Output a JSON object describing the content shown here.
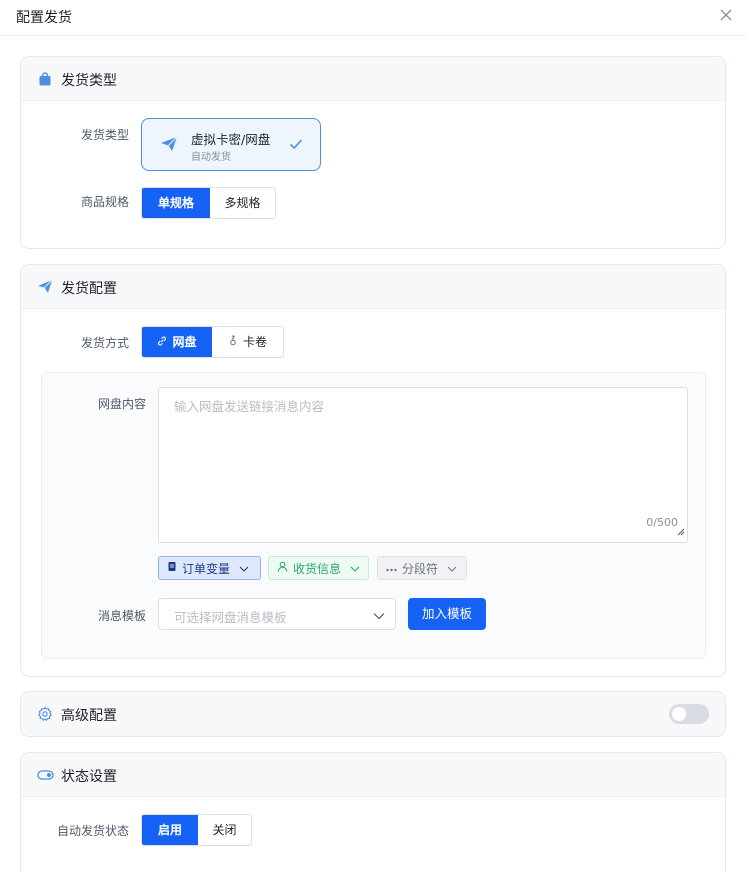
{
  "modal": {
    "title": "配置发货"
  },
  "section_delivery_type": {
    "title": "发货类型",
    "type_label": "发货类型",
    "type_card": {
      "title": "虚拟卡密/网盘",
      "subtitle": "自动发货",
      "selected": true
    },
    "spec_label": "商品规格",
    "spec_options": [
      "单规格",
      "多规格"
    ],
    "spec_selected": "单规格"
  },
  "section_delivery_config": {
    "title": "发货配置",
    "method_label": "发货方式",
    "method_options": [
      "网盘",
      "卡卷"
    ],
    "method_selected": "网盘",
    "content_label": "网盘内容",
    "content_placeholder": "输入网盘发送链接消息内容",
    "content_value": "",
    "char_count": "0/500",
    "chips": [
      "订单变量",
      "收货信息",
      "分段符"
    ],
    "template_label": "消息模板",
    "template_placeholder": "可选择网盘消息模板",
    "add_template_button": "加入模板"
  },
  "section_advanced": {
    "title": "高级配置",
    "enabled": false
  },
  "section_status": {
    "title": "状态设置",
    "auto_label": "自动发货状态",
    "options": [
      "启用",
      "关闭"
    ],
    "selected": "启用"
  },
  "colors": {
    "primary": "#1662f5",
    "selected_border": "#4a90e2",
    "green": "#2da66a"
  }
}
